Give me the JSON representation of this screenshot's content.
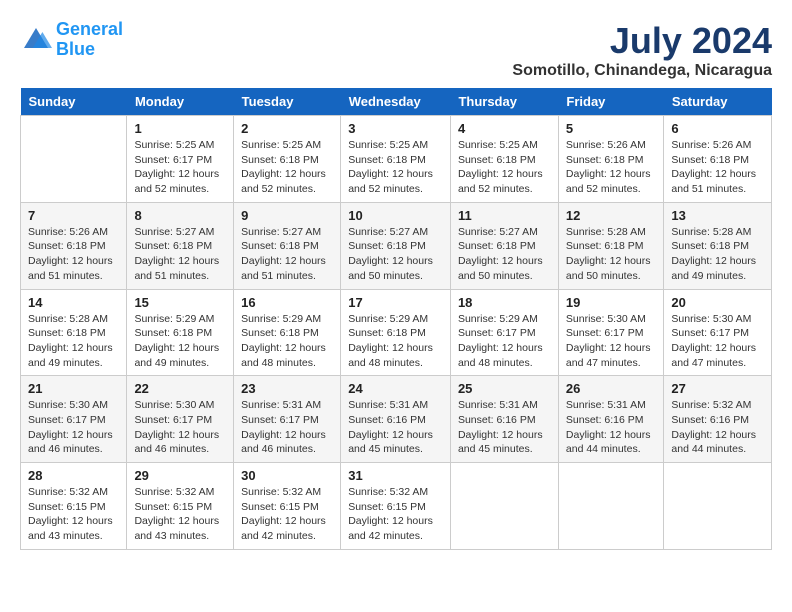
{
  "logo": {
    "line1": "General",
    "line2": "Blue"
  },
  "title": "July 2024",
  "location": "Somotillo, Chinandega, Nicaragua",
  "days_of_week": [
    "Sunday",
    "Monday",
    "Tuesday",
    "Wednesday",
    "Thursday",
    "Friday",
    "Saturday"
  ],
  "weeks": [
    [
      {
        "day": "",
        "sunrise": "",
        "sunset": "",
        "daylight": ""
      },
      {
        "day": "1",
        "sunrise": "Sunrise: 5:25 AM",
        "sunset": "Sunset: 6:17 PM",
        "daylight": "Daylight: 12 hours and 52 minutes."
      },
      {
        "day": "2",
        "sunrise": "Sunrise: 5:25 AM",
        "sunset": "Sunset: 6:18 PM",
        "daylight": "Daylight: 12 hours and 52 minutes."
      },
      {
        "day": "3",
        "sunrise": "Sunrise: 5:25 AM",
        "sunset": "Sunset: 6:18 PM",
        "daylight": "Daylight: 12 hours and 52 minutes."
      },
      {
        "day": "4",
        "sunrise": "Sunrise: 5:25 AM",
        "sunset": "Sunset: 6:18 PM",
        "daylight": "Daylight: 12 hours and 52 minutes."
      },
      {
        "day": "5",
        "sunrise": "Sunrise: 5:26 AM",
        "sunset": "Sunset: 6:18 PM",
        "daylight": "Daylight: 12 hours and 52 minutes."
      },
      {
        "day": "6",
        "sunrise": "Sunrise: 5:26 AM",
        "sunset": "Sunset: 6:18 PM",
        "daylight": "Daylight: 12 hours and 51 minutes."
      }
    ],
    [
      {
        "day": "7",
        "sunrise": "Sunrise: 5:26 AM",
        "sunset": "Sunset: 6:18 PM",
        "daylight": "Daylight: 12 hours and 51 minutes."
      },
      {
        "day": "8",
        "sunrise": "Sunrise: 5:27 AM",
        "sunset": "Sunset: 6:18 PM",
        "daylight": "Daylight: 12 hours and 51 minutes."
      },
      {
        "day": "9",
        "sunrise": "Sunrise: 5:27 AM",
        "sunset": "Sunset: 6:18 PM",
        "daylight": "Daylight: 12 hours and 51 minutes."
      },
      {
        "day": "10",
        "sunrise": "Sunrise: 5:27 AM",
        "sunset": "Sunset: 6:18 PM",
        "daylight": "Daylight: 12 hours and 50 minutes."
      },
      {
        "day": "11",
        "sunrise": "Sunrise: 5:27 AM",
        "sunset": "Sunset: 6:18 PM",
        "daylight": "Daylight: 12 hours and 50 minutes."
      },
      {
        "day": "12",
        "sunrise": "Sunrise: 5:28 AM",
        "sunset": "Sunset: 6:18 PM",
        "daylight": "Daylight: 12 hours and 50 minutes."
      },
      {
        "day": "13",
        "sunrise": "Sunrise: 5:28 AM",
        "sunset": "Sunset: 6:18 PM",
        "daylight": "Daylight: 12 hours and 49 minutes."
      }
    ],
    [
      {
        "day": "14",
        "sunrise": "Sunrise: 5:28 AM",
        "sunset": "Sunset: 6:18 PM",
        "daylight": "Daylight: 12 hours and 49 minutes."
      },
      {
        "day": "15",
        "sunrise": "Sunrise: 5:29 AM",
        "sunset": "Sunset: 6:18 PM",
        "daylight": "Daylight: 12 hours and 49 minutes."
      },
      {
        "day": "16",
        "sunrise": "Sunrise: 5:29 AM",
        "sunset": "Sunset: 6:18 PM",
        "daylight": "Daylight: 12 hours and 48 minutes."
      },
      {
        "day": "17",
        "sunrise": "Sunrise: 5:29 AM",
        "sunset": "Sunset: 6:18 PM",
        "daylight": "Daylight: 12 hours and 48 minutes."
      },
      {
        "day": "18",
        "sunrise": "Sunrise: 5:29 AM",
        "sunset": "Sunset: 6:17 PM",
        "daylight": "Daylight: 12 hours and 48 minutes."
      },
      {
        "day": "19",
        "sunrise": "Sunrise: 5:30 AM",
        "sunset": "Sunset: 6:17 PM",
        "daylight": "Daylight: 12 hours and 47 minutes."
      },
      {
        "day": "20",
        "sunrise": "Sunrise: 5:30 AM",
        "sunset": "Sunset: 6:17 PM",
        "daylight": "Daylight: 12 hours and 47 minutes."
      }
    ],
    [
      {
        "day": "21",
        "sunrise": "Sunrise: 5:30 AM",
        "sunset": "Sunset: 6:17 PM",
        "daylight": "Daylight: 12 hours and 46 minutes."
      },
      {
        "day": "22",
        "sunrise": "Sunrise: 5:30 AM",
        "sunset": "Sunset: 6:17 PM",
        "daylight": "Daylight: 12 hours and 46 minutes."
      },
      {
        "day": "23",
        "sunrise": "Sunrise: 5:31 AM",
        "sunset": "Sunset: 6:17 PM",
        "daylight": "Daylight: 12 hours and 46 minutes."
      },
      {
        "day": "24",
        "sunrise": "Sunrise: 5:31 AM",
        "sunset": "Sunset: 6:16 PM",
        "daylight": "Daylight: 12 hours and 45 minutes."
      },
      {
        "day": "25",
        "sunrise": "Sunrise: 5:31 AM",
        "sunset": "Sunset: 6:16 PM",
        "daylight": "Daylight: 12 hours and 45 minutes."
      },
      {
        "day": "26",
        "sunrise": "Sunrise: 5:31 AM",
        "sunset": "Sunset: 6:16 PM",
        "daylight": "Daylight: 12 hours and 44 minutes."
      },
      {
        "day": "27",
        "sunrise": "Sunrise: 5:32 AM",
        "sunset": "Sunset: 6:16 PM",
        "daylight": "Daylight: 12 hours and 44 minutes."
      }
    ],
    [
      {
        "day": "28",
        "sunrise": "Sunrise: 5:32 AM",
        "sunset": "Sunset: 6:15 PM",
        "daylight": "Daylight: 12 hours and 43 minutes."
      },
      {
        "day": "29",
        "sunrise": "Sunrise: 5:32 AM",
        "sunset": "Sunset: 6:15 PM",
        "daylight": "Daylight: 12 hours and 43 minutes."
      },
      {
        "day": "30",
        "sunrise": "Sunrise: 5:32 AM",
        "sunset": "Sunset: 6:15 PM",
        "daylight": "Daylight: 12 hours and 42 minutes."
      },
      {
        "day": "31",
        "sunrise": "Sunrise: 5:32 AM",
        "sunset": "Sunset: 6:15 PM",
        "daylight": "Daylight: 12 hours and 42 minutes."
      },
      {
        "day": "",
        "sunrise": "",
        "sunset": "",
        "daylight": ""
      },
      {
        "day": "",
        "sunrise": "",
        "sunset": "",
        "daylight": ""
      },
      {
        "day": "",
        "sunrise": "",
        "sunset": "",
        "daylight": ""
      }
    ]
  ]
}
